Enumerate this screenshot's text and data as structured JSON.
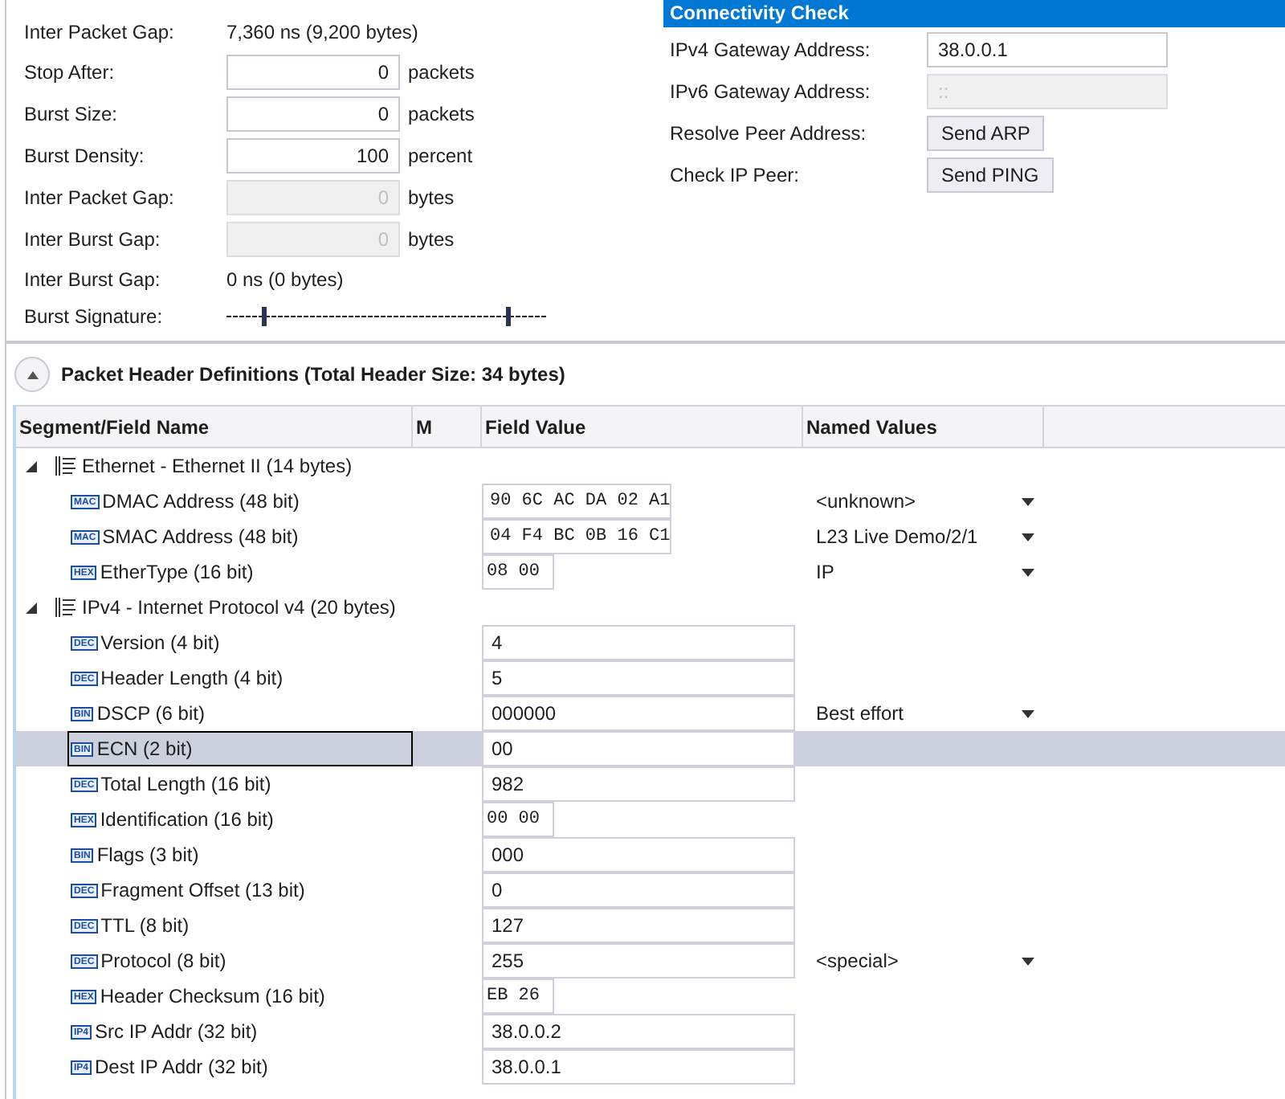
{
  "rate_panel": {
    "rows": [
      {
        "kind": "text",
        "label": "Inter Packet Gap:",
        "value": "7,360 ns (9,200 bytes)"
      },
      {
        "kind": "field",
        "label": "Stop After:",
        "value": "0",
        "unit": "packets",
        "disabled": false
      },
      {
        "kind": "field",
        "label": "Burst Size:",
        "value": "0",
        "unit": "packets",
        "disabled": false
      },
      {
        "kind": "field",
        "label": "Burst Density:",
        "value": "100",
        "unit": "percent",
        "disabled": false
      },
      {
        "kind": "field",
        "label": "Inter Packet Gap:",
        "value": "0",
        "unit": "bytes",
        "disabled": true
      },
      {
        "kind": "field",
        "label": "Inter Burst Gap:",
        "value": "0",
        "unit": "bytes",
        "disabled": true
      },
      {
        "kind": "text",
        "label": "Inter Burst Gap:",
        "value": "0 ns (0 bytes)"
      },
      {
        "kind": "signature",
        "label": "Burst Signature:"
      }
    ]
  },
  "connectivity": {
    "title": "Connectivity Check",
    "rows": [
      {
        "kind": "field",
        "label": "IPv4 Gateway Address:",
        "value": "38.0.0.1",
        "disabled": false
      },
      {
        "kind": "field",
        "label": "IPv6 Gateway Address:",
        "value": "::",
        "disabled": true
      },
      {
        "kind": "button",
        "label": "Resolve Peer Address:",
        "button": "Send ARP"
      },
      {
        "kind": "button",
        "label": "Check IP Peer:",
        "button": "Send PING"
      }
    ]
  },
  "headers": {
    "title": "Packet Header Definitions (Total Header Size: 34 bytes)",
    "expanded": true,
    "columns": [
      "Segment/Field Name",
      "M",
      "Field Value",
      "Named Values"
    ],
    "segments": [
      {
        "name": "Ethernet - Ethernet II (14 bytes)",
        "expanded": true,
        "children": [
          {
            "type_tag": "MAC",
            "name": "DMAC Address (48 bit)",
            "kind": "mac",
            "value": "90 6C AC DA 02 A1",
            "named_value": "<unknown>",
            "selected": false
          },
          {
            "type_tag": "MAC",
            "name": "SMAC Address (48 bit)",
            "kind": "mac",
            "value": "04 F4 BC 0B 16 C1",
            "named_value": "L23 Live Demo/2/1",
            "selected": false
          },
          {
            "type_tag": "HEX",
            "name": "EtherType (16 bit)",
            "kind": "hex",
            "value": "08 00",
            "named_value": "IP",
            "selected": false
          }
        ]
      },
      {
        "name": "IPv4 - Internet Protocol v4 (20 bytes)",
        "expanded": true,
        "children": [
          {
            "type_tag": "DEC",
            "name": "Version (4 bit)",
            "kind": "plain",
            "value": "4",
            "selected": false
          },
          {
            "type_tag": "DEC",
            "name": "Header Length (4 bit)",
            "kind": "plain",
            "value": "5",
            "selected": false
          },
          {
            "type_tag": "BIN",
            "name": "DSCP (6 bit)",
            "kind": "plain",
            "value": "000000",
            "named_value": "Best effort",
            "selected": false
          },
          {
            "type_tag": "BIN",
            "name": "ECN (2 bit)",
            "kind": "plain",
            "value": "00",
            "selected": true
          },
          {
            "type_tag": "DEC",
            "name": "Total Length (16 bit)",
            "kind": "plain",
            "value": "982",
            "selected": false
          },
          {
            "type_tag": "HEX",
            "name": "Identification (16 bit)",
            "kind": "hex",
            "value": "00 00",
            "selected": false
          },
          {
            "type_tag": "BIN",
            "name": "Flags (3 bit)",
            "kind": "plain",
            "value": "000",
            "selected": false
          },
          {
            "type_tag": "DEC",
            "name": "Fragment Offset (13 bit)",
            "kind": "plain",
            "value": "0",
            "selected": false
          },
          {
            "type_tag": "DEC",
            "name": "TTL (8 bit)",
            "kind": "plain",
            "value": "127",
            "selected": false
          },
          {
            "type_tag": "DEC",
            "name": "Protocol (8 bit)",
            "kind": "plain",
            "value": "255",
            "named_value": "<special>",
            "selected": false
          },
          {
            "type_tag": "HEX",
            "name": "Header Checksum (16 bit)",
            "kind": "hex",
            "value": "EB 26",
            "selected": false
          },
          {
            "type_tag": "IP4",
            "name": "Src IP Addr (32 bit)",
            "kind": "plain",
            "value": "38.0.0.2",
            "selected": false
          },
          {
            "type_tag": "IP4",
            "name": "Dest IP Addr (32 bit)",
            "kind": "plain",
            "value": "38.0.0.1",
            "selected": false
          }
        ]
      }
    ]
  }
}
